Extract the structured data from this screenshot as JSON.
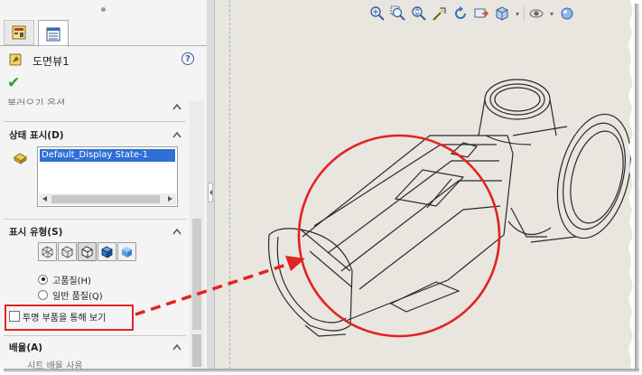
{
  "panel": {
    "header_title": "도면뷰1",
    "help_label": "?",
    "section_partial": "불러오기 옵션",
    "display_state": {
      "title": "상태 표시(D)",
      "selected_item": "Default_Display State-1"
    },
    "display_style": {
      "title": "표시 유형(S)",
      "icons": [
        "wireframe-icon",
        "hidden-lines-visible-icon",
        "hidden-lines-removed-icon",
        "shaded-with-edges-icon",
        "shaded-icon"
      ],
      "radio_high_quality": "고품질(H)",
      "radio_draft_quality": "일반 품질(Q)",
      "selected_quality": "고품질(H)"
    },
    "see_through_label": "투명 부품을 통해 보기",
    "see_through_checked": false,
    "scale": {
      "title": "배율(A)",
      "partial_option": "시트 배율 사용"
    }
  },
  "toolbar": {
    "icons": [
      "zoom-to-fit-icon",
      "zoom-to-area-icon",
      "zoom-in-out-icon",
      "zoom-to-selection-icon",
      "rotate-icon",
      "pan-icon",
      "view-orientation-icon",
      "display-style-icon",
      "hide-show-items-icon",
      "appearance-icon"
    ]
  },
  "colors": {
    "highlight_red": "#e32222",
    "selection_blue": "#2f6fd6",
    "viewport_bg": "#e8e6df",
    "accept_green": "#2c9e2c"
  }
}
